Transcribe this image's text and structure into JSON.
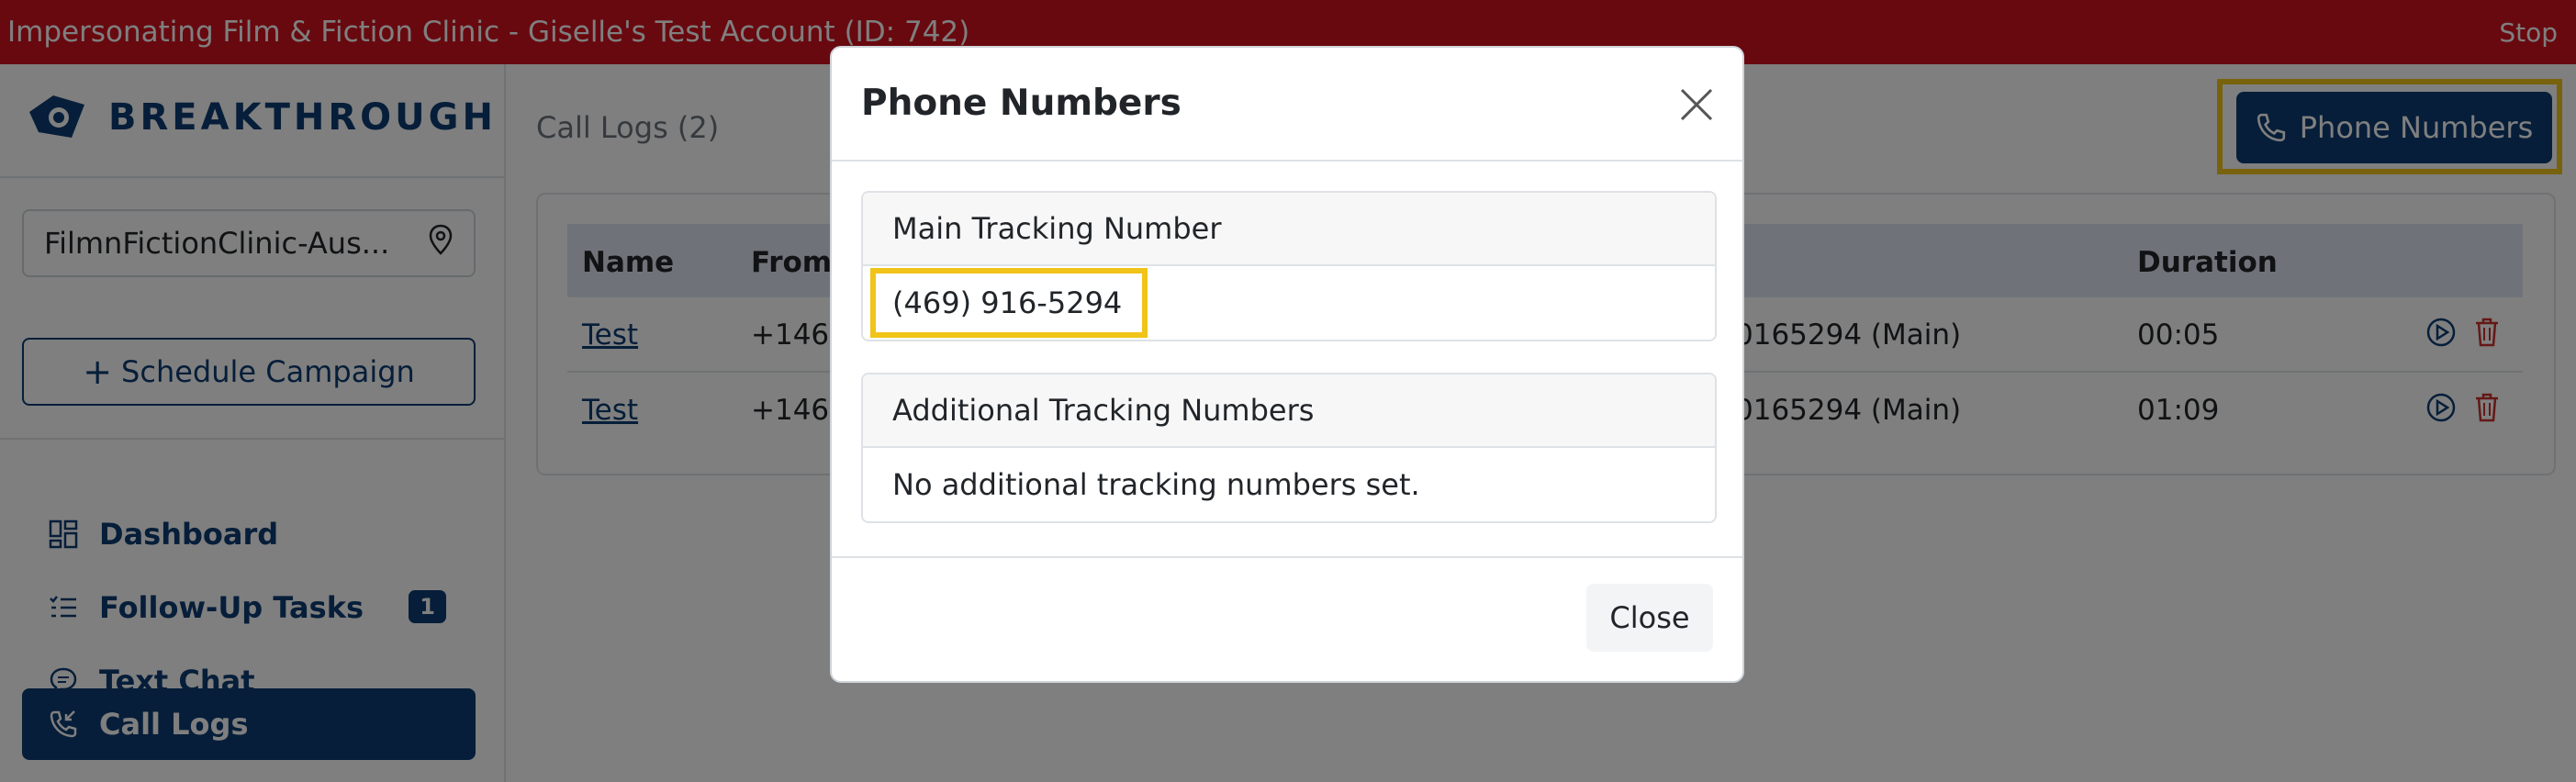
{
  "banner": {
    "text": "Impersonating Film & Fiction Clinic - Giselle's Test Account (ID: 742)",
    "stop": "Stop"
  },
  "sidebar": {
    "logo_text": "BREAKTHROUGH",
    "location": "FilmnFictionClinic-Aus...",
    "schedule_button": "Schedule Campaign",
    "items": [
      {
        "label": "Dashboard",
        "icon": "dashboard-icon"
      },
      {
        "label": "Follow-Up Tasks",
        "icon": "list-icon",
        "badge": "1"
      },
      {
        "label": "Text Chat",
        "icon": "chat-icon"
      },
      {
        "label": "Call Logs",
        "icon": "phone-incoming-icon",
        "active": true
      }
    ]
  },
  "main": {
    "title": "Call Logs (2)",
    "phone_numbers_button": "Phone Numbers",
    "table": {
      "headers": [
        "Name",
        "From",
        "Duration"
      ],
      "rows": [
        {
          "name": "Test",
          "from": "+1469",
          "to": "0165294 (Main)",
          "duration": "00:05"
        },
        {
          "name": "Test",
          "from": "+1469",
          "to": "0165294 (Main)",
          "duration": "01:09"
        }
      ]
    }
  },
  "modal": {
    "title": "Phone Numbers",
    "main_label": "Main Tracking Number",
    "main_number": "(469) 916-5294",
    "additional_label": "Additional Tracking Numbers",
    "additional_text": "No additional tracking numbers set.",
    "close_label": "Close"
  },
  "colors": {
    "brand": "#0d3c73",
    "banner": "#d0121f",
    "highlight": "#f0c419",
    "delete": "#c9302c"
  }
}
